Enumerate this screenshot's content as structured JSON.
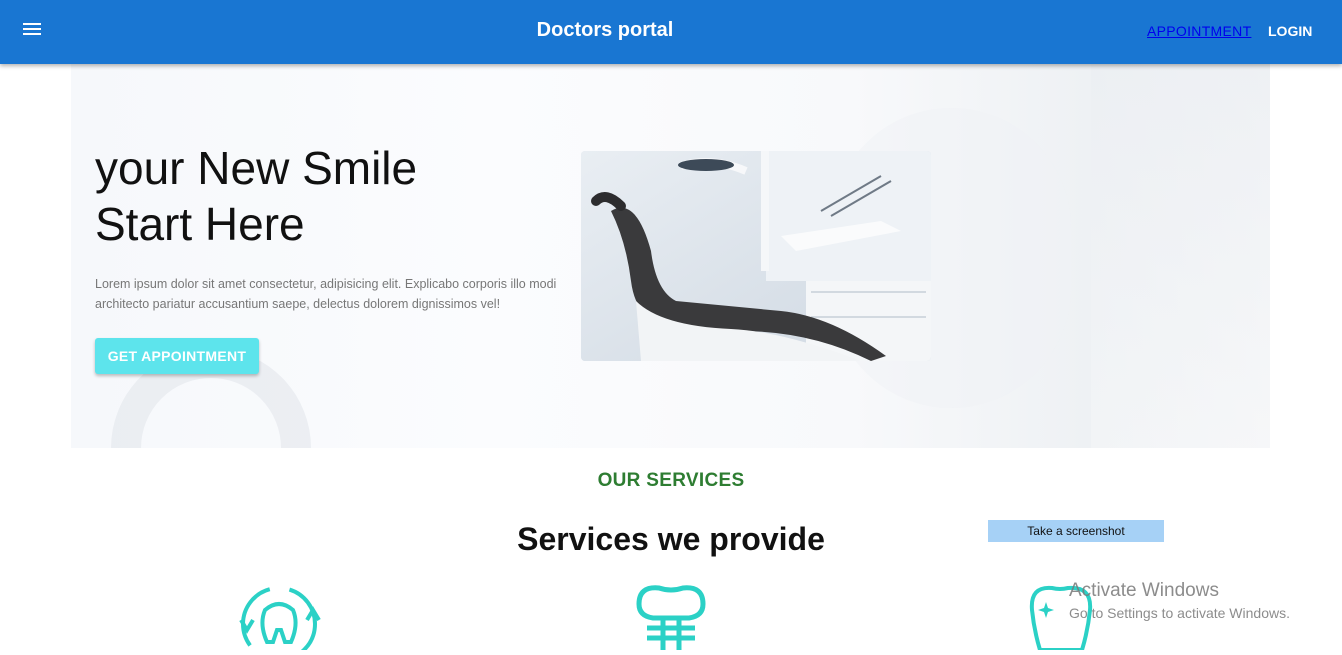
{
  "header": {
    "brand": "Doctors portal",
    "nav": {
      "appointment": "APPOINTMENT",
      "login": "LOGIN"
    }
  },
  "hero": {
    "title_line1": "your New Smile",
    "title_line2": "Start Here",
    "text": "Lorem ipsum dolor sit amet consectetur, adipisicing elit. Explicabo corporis illo modi architecto pariatur accusantium saepe, delectus dolorem dignissimos vel!",
    "cta": "GET APPOINTMENT"
  },
  "services": {
    "eyebrow": "OUR SERVICES",
    "title": "Services we provide",
    "icons": [
      "tooth-cycle-icon",
      "tooth-implant-icon",
      "tooth-whitening-icon"
    ]
  },
  "overlay": {
    "screenshot_button": "Take a screenshot",
    "activate_title": "Activate Windows",
    "activate_text": "Go to Settings to activate Windows."
  },
  "colors": {
    "appbar": "#1976d2",
    "cta": "#5de4ec",
    "eyebrow": "#2e7d32",
    "icon": "#2bd1c6"
  }
}
